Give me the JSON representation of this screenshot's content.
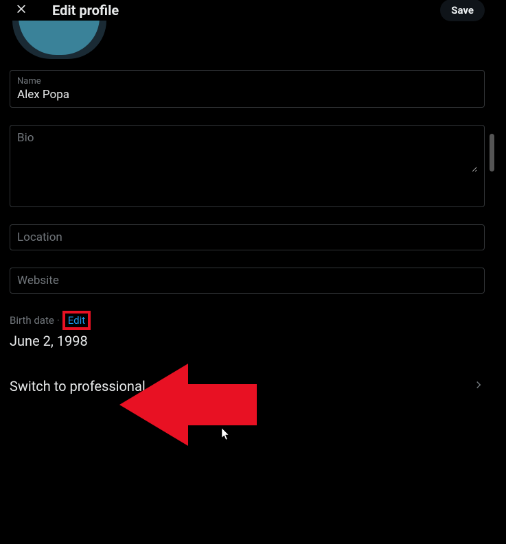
{
  "header": {
    "title": "Edit profile",
    "save_label": "Save"
  },
  "fields": {
    "name": {
      "label": "Name",
      "value": "Alex Popa"
    },
    "bio": {
      "label": "Bio",
      "value": ""
    },
    "location": {
      "label": "Location",
      "value": ""
    },
    "website": {
      "label": "Website",
      "value": ""
    }
  },
  "birth": {
    "label": "Birth date",
    "separator": "·",
    "edit_label": "Edit",
    "value": "June 2, 1998"
  },
  "switch": {
    "label": "Switch to professional"
  },
  "colors": {
    "accent": "#1d9bf0",
    "highlight_box": "#e81123",
    "avatar_fill": "#3a8299"
  }
}
